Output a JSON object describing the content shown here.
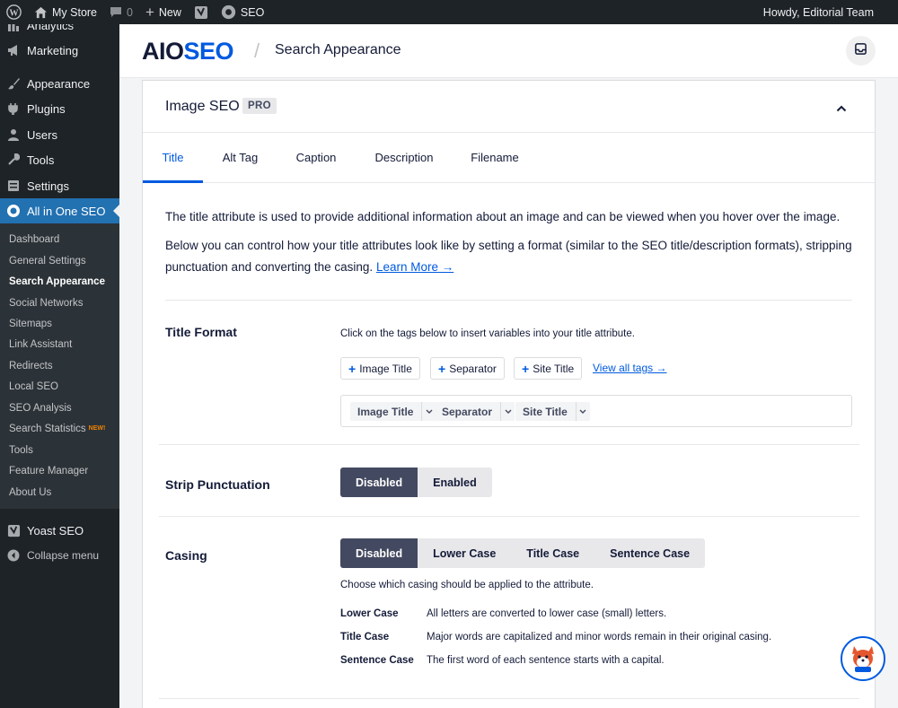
{
  "adminbar": {
    "site_name": "My Store",
    "comments_count": "0",
    "new_label": "New",
    "seo_label": "SEO",
    "howdy": "Howdy, Editorial Team"
  },
  "sidebar": {
    "items": [
      {
        "label": "Analytics",
        "icon": "bar-chart-icon"
      },
      {
        "label": "Marketing",
        "icon": "megaphone-icon"
      },
      {
        "label": "Appearance",
        "icon": "paintbrush-icon"
      },
      {
        "label": "Plugins",
        "icon": "plugin-icon"
      },
      {
        "label": "Users",
        "icon": "user-icon"
      },
      {
        "label": "Tools",
        "icon": "wrench-icon"
      },
      {
        "label": "Settings",
        "icon": "settings-icon"
      },
      {
        "label": "All in One SEO",
        "icon": "aioseo-icon"
      }
    ],
    "submenu": [
      "Dashboard",
      "General Settings",
      "Search Appearance",
      "Social Networks",
      "Sitemaps",
      "Link Assistant",
      "Redirects",
      "Local SEO",
      "SEO Analysis",
      "Search Statistics",
      "Tools",
      "Feature Manager",
      "About Us"
    ],
    "new_badge": "NEW!",
    "yoast_label": "Yoast SEO",
    "collapse_label": "Collapse menu"
  },
  "header": {
    "logo_aio": "AIO",
    "logo_seo": "SEO",
    "separator": "/",
    "page_title": "Search Appearance"
  },
  "card": {
    "title": "Image SEO",
    "badge": "PRO",
    "tabs": [
      "Title",
      "Alt Tag",
      "Caption",
      "Description",
      "Filename"
    ],
    "desc1": "The title attribute is used to provide additional information about an image and can be viewed when you hover over the image.",
    "desc2": "Below you can control how your title attributes look like by setting a format (similar to the SEO title/description formats), stripping punctuation and converting the casing.",
    "learn_more": "Learn More →"
  },
  "title_format": {
    "label": "Title Format",
    "help": "Click on the tags below to insert variables into your title attribute.",
    "tags": [
      "Image Title",
      "Separator",
      "Site Title"
    ],
    "view_all": "View all tags →",
    "chips": [
      "Image Title",
      "Separator",
      "Site Title"
    ]
  },
  "strip_punctuation": {
    "label": "Strip Punctuation",
    "options": [
      "Disabled",
      "Enabled"
    ],
    "selected": "Disabled"
  },
  "casing": {
    "label": "Casing",
    "options": [
      "Disabled",
      "Lower Case",
      "Title Case",
      "Sentence Case"
    ],
    "selected": "Disabled",
    "help": "Choose which casing should be applied to the attribute.",
    "info": [
      {
        "term": "Lower Case",
        "desc": "All letters are converted to lower case (small) letters."
      },
      {
        "term": "Title Case",
        "desc": "Major words are capitalized and minor words remain in their original casing."
      },
      {
        "term": "Sentence Case",
        "desc": "The first word of each sentence starts with a capital."
      }
    ]
  },
  "colors": {
    "accent": "#005ae0",
    "wp_blue": "#2271b1",
    "dark": "#1d2327",
    "toggle_selected": "#434960"
  }
}
